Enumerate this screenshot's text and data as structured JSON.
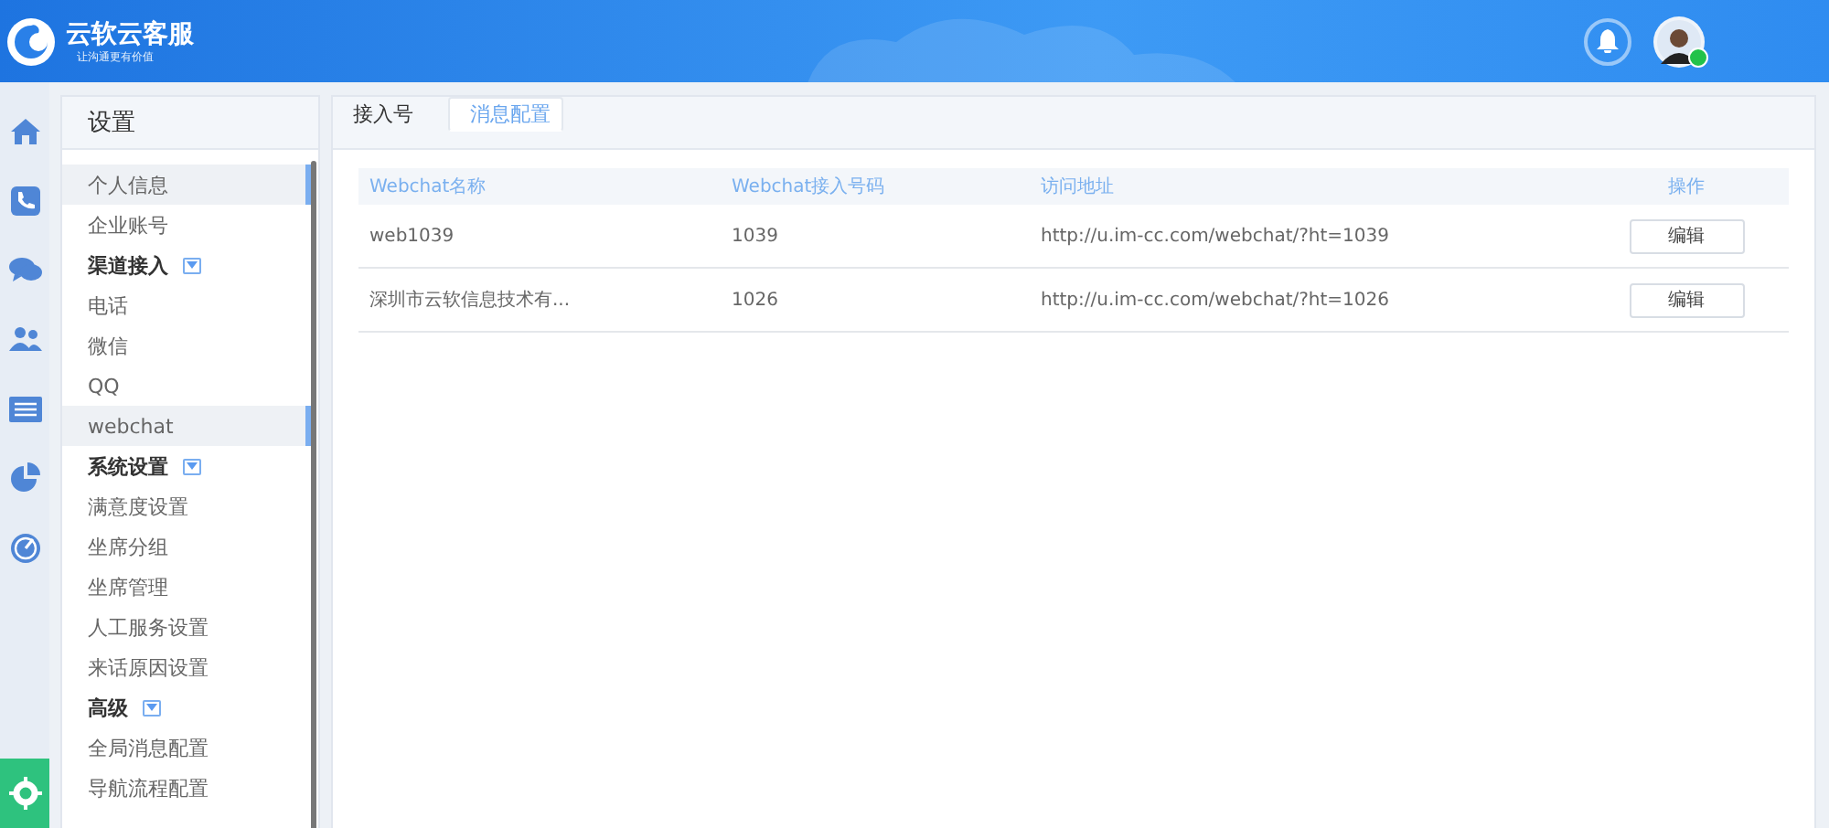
{
  "header": {
    "title": "云软云客服",
    "slogan": "让沟通更有价值",
    "agent_online": true
  },
  "rail": [
    {
      "kind": "home",
      "selected": false
    },
    {
      "kind": "phone",
      "selected": false
    },
    {
      "kind": "chat",
      "selected": false
    },
    {
      "kind": "users",
      "selected": false
    },
    {
      "kind": "list",
      "selected": false
    },
    {
      "kind": "pie",
      "selected": false
    },
    {
      "kind": "gauge",
      "selected": false
    },
    {
      "kind": "gear",
      "selected": true
    }
  ],
  "settings": {
    "title": "设置",
    "items": [
      {
        "label": "个人信息",
        "kind": "item",
        "selected": true
      },
      {
        "label": "企业账号",
        "kind": "item",
        "selected": false
      },
      {
        "label": "渠道接入",
        "kind": "group",
        "selected": false
      },
      {
        "label": "电话",
        "kind": "item",
        "selected": false
      },
      {
        "label": "微信",
        "kind": "item",
        "selected": false
      },
      {
        "label": "QQ",
        "kind": "item",
        "selected": false
      },
      {
        "label": "webchat",
        "kind": "item",
        "selected": true
      },
      {
        "label": "系统设置",
        "kind": "group",
        "selected": false
      },
      {
        "label": "满意度设置",
        "kind": "item",
        "selected": false
      },
      {
        "label": "坐席分组",
        "kind": "item",
        "selected": false
      },
      {
        "label": "坐席管理",
        "kind": "item",
        "selected": false
      },
      {
        "label": "人工服务设置",
        "kind": "item",
        "selected": false
      },
      {
        "label": "来话原因设置",
        "kind": "item",
        "selected": false
      },
      {
        "label": "高级",
        "kind": "group",
        "selected": false
      },
      {
        "label": "全局消息配置",
        "kind": "item",
        "selected": false
      },
      {
        "label": "导航流程配置",
        "kind": "item",
        "selected": false
      }
    ]
  },
  "tabs": [
    {
      "label": "接入号",
      "selected": false
    },
    {
      "label": "消息配置",
      "selected": true
    }
  ],
  "table": {
    "columns": [
      "Webchat名称",
      "Webchat接入号码",
      "访问地址",
      "操作"
    ],
    "rows": [
      {
        "name": "web1039",
        "number": "1039",
        "url": "http://u.im-cc.com/webchat/?ht=1039",
        "action": "编辑"
      },
      {
        "name": "深圳市云软信息技术有...",
        "number": "1026",
        "url": "http://u.im-cc.com/webchat/?ht=1026",
        "action": "编辑"
      }
    ]
  }
}
